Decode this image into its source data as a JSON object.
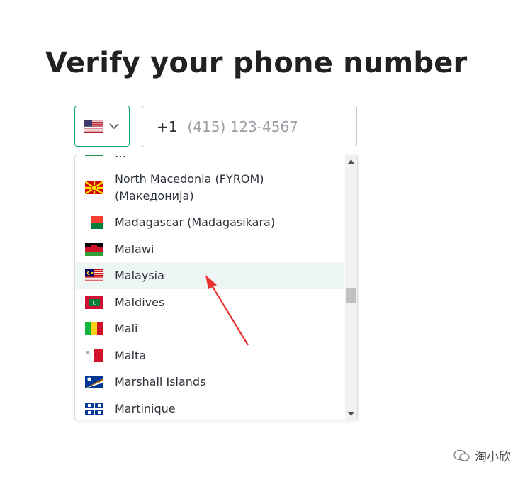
{
  "page": {
    "title": "Verify your phone number"
  },
  "country_select": {
    "selected_flag": "us-flag-icon",
    "chevron": "chevron-down-icon"
  },
  "phone": {
    "dial_code": "+1",
    "placeholder": "(415) 123-4567",
    "value": ""
  },
  "dropdown": {
    "items": [
      {
        "label": "…",
        "flag": "partial-flag-icon"
      },
      {
        "label": "North Macedonia (FYROM)",
        "label_line2": "(Македонија)",
        "flag": "north-macedonia-flag-icon"
      },
      {
        "label": "Madagascar (Madagasikara)",
        "flag": "madagascar-flag-icon"
      },
      {
        "label": "Malawi",
        "flag": "malawi-flag-icon"
      },
      {
        "label": "Malaysia",
        "flag": "malaysia-flag-icon",
        "highlighted": true
      },
      {
        "label": "Maldives",
        "flag": "maldives-flag-icon"
      },
      {
        "label": "Mali",
        "flag": "mali-flag-icon"
      },
      {
        "label": "Malta",
        "flag": "malta-flag-icon"
      },
      {
        "label": "Marshall Islands",
        "flag": "marshall-islands-flag-icon"
      },
      {
        "label": "Martinique",
        "flag": "martinique-flag-icon"
      }
    ]
  },
  "annotation": {
    "arrow_color": "#e8322f"
  },
  "watermark": {
    "text": "淘小欣",
    "icon": "wechat-icon"
  },
  "colors": {
    "accent": "#10a37f",
    "highlight_bg": "#eef5f5",
    "text": "#2d333a",
    "placeholder": "#9aa0a6"
  }
}
